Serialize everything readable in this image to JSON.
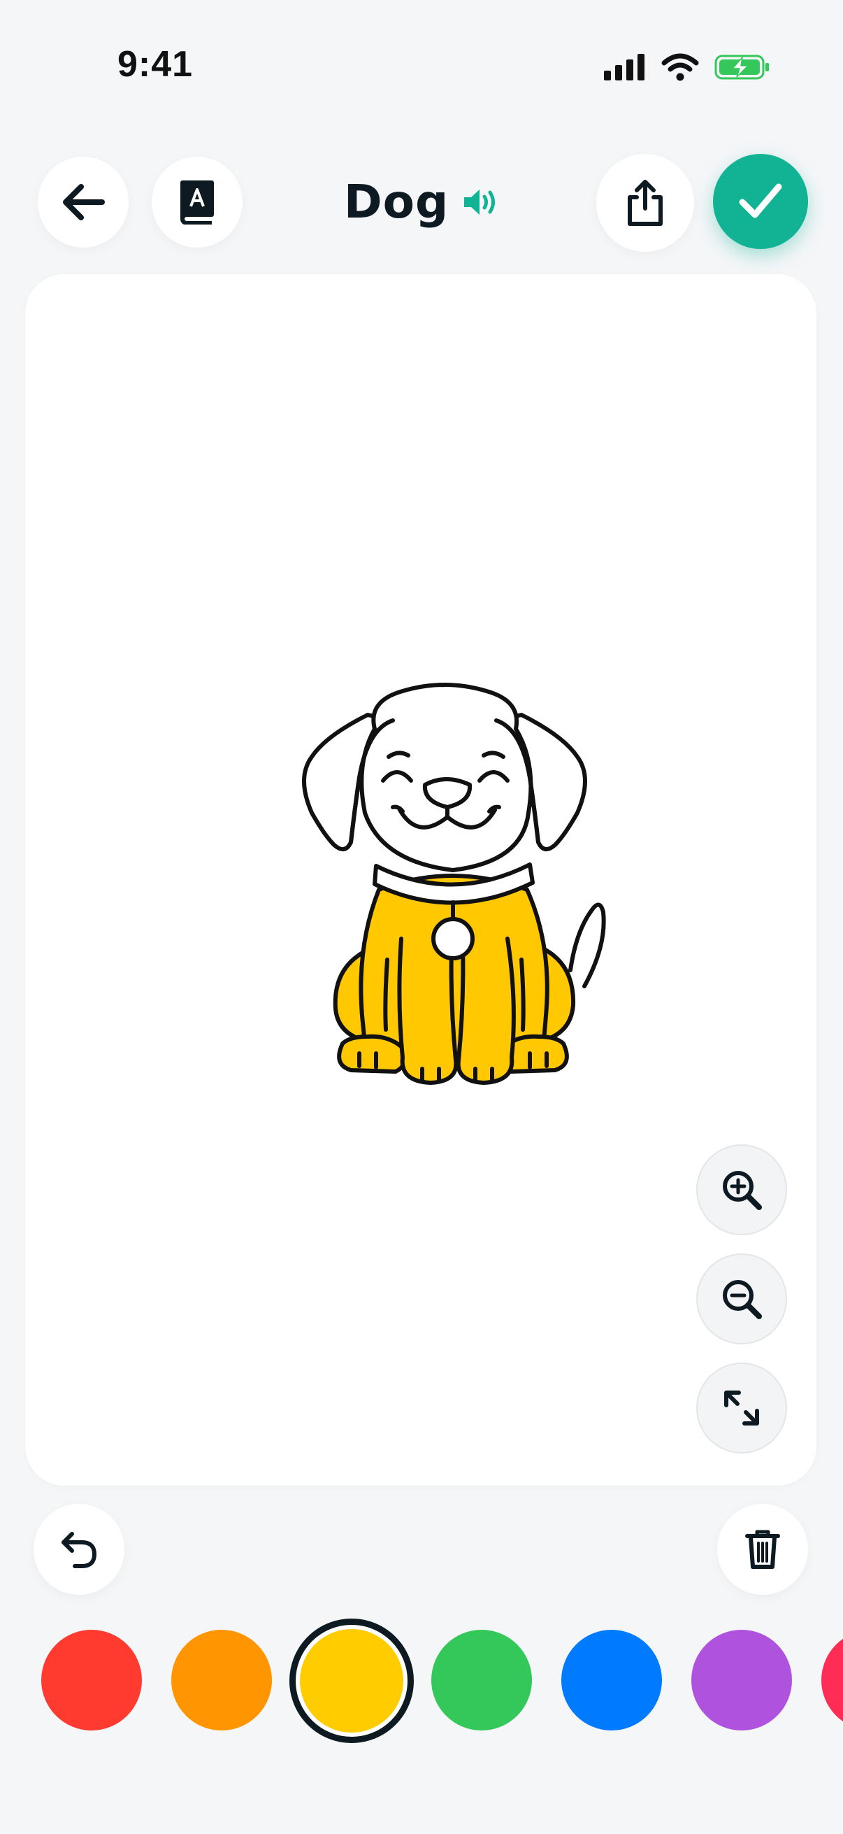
{
  "status_bar": {
    "time": "9:41",
    "icons": [
      "cellular-signal-icon",
      "wifi-icon",
      "battery-charging-icon"
    ],
    "battery_color": "#34C759"
  },
  "header": {
    "title": "Dog",
    "buttons": [
      "back-arrow-icon",
      "dictionary-book-icon",
      "speaker-icon",
      "share-icon",
      "checkmark-icon"
    ],
    "accent_color": "#12B394"
  },
  "canvas": {
    "image": "dog-coloring-page",
    "fill_color": "#FFC800",
    "zoom_controls": [
      "zoom-in-icon",
      "zoom-out-icon",
      "fit-to-screen-icon"
    ]
  },
  "tools": [
    "undo-icon",
    "trash-icon"
  ],
  "palette": {
    "colors": [
      {
        "name": "red",
        "hex": "#FF3B30"
      },
      {
        "name": "orange",
        "hex": "#FF9500"
      },
      {
        "name": "yellow",
        "hex": "#FFCC00"
      },
      {
        "name": "green",
        "hex": "#34C759"
      },
      {
        "name": "blue",
        "hex": "#007AFF"
      },
      {
        "name": "purple",
        "hex": "#AF52DE"
      },
      {
        "name": "pink",
        "hex": "#FF2D55"
      }
    ],
    "selected": "yellow"
  }
}
